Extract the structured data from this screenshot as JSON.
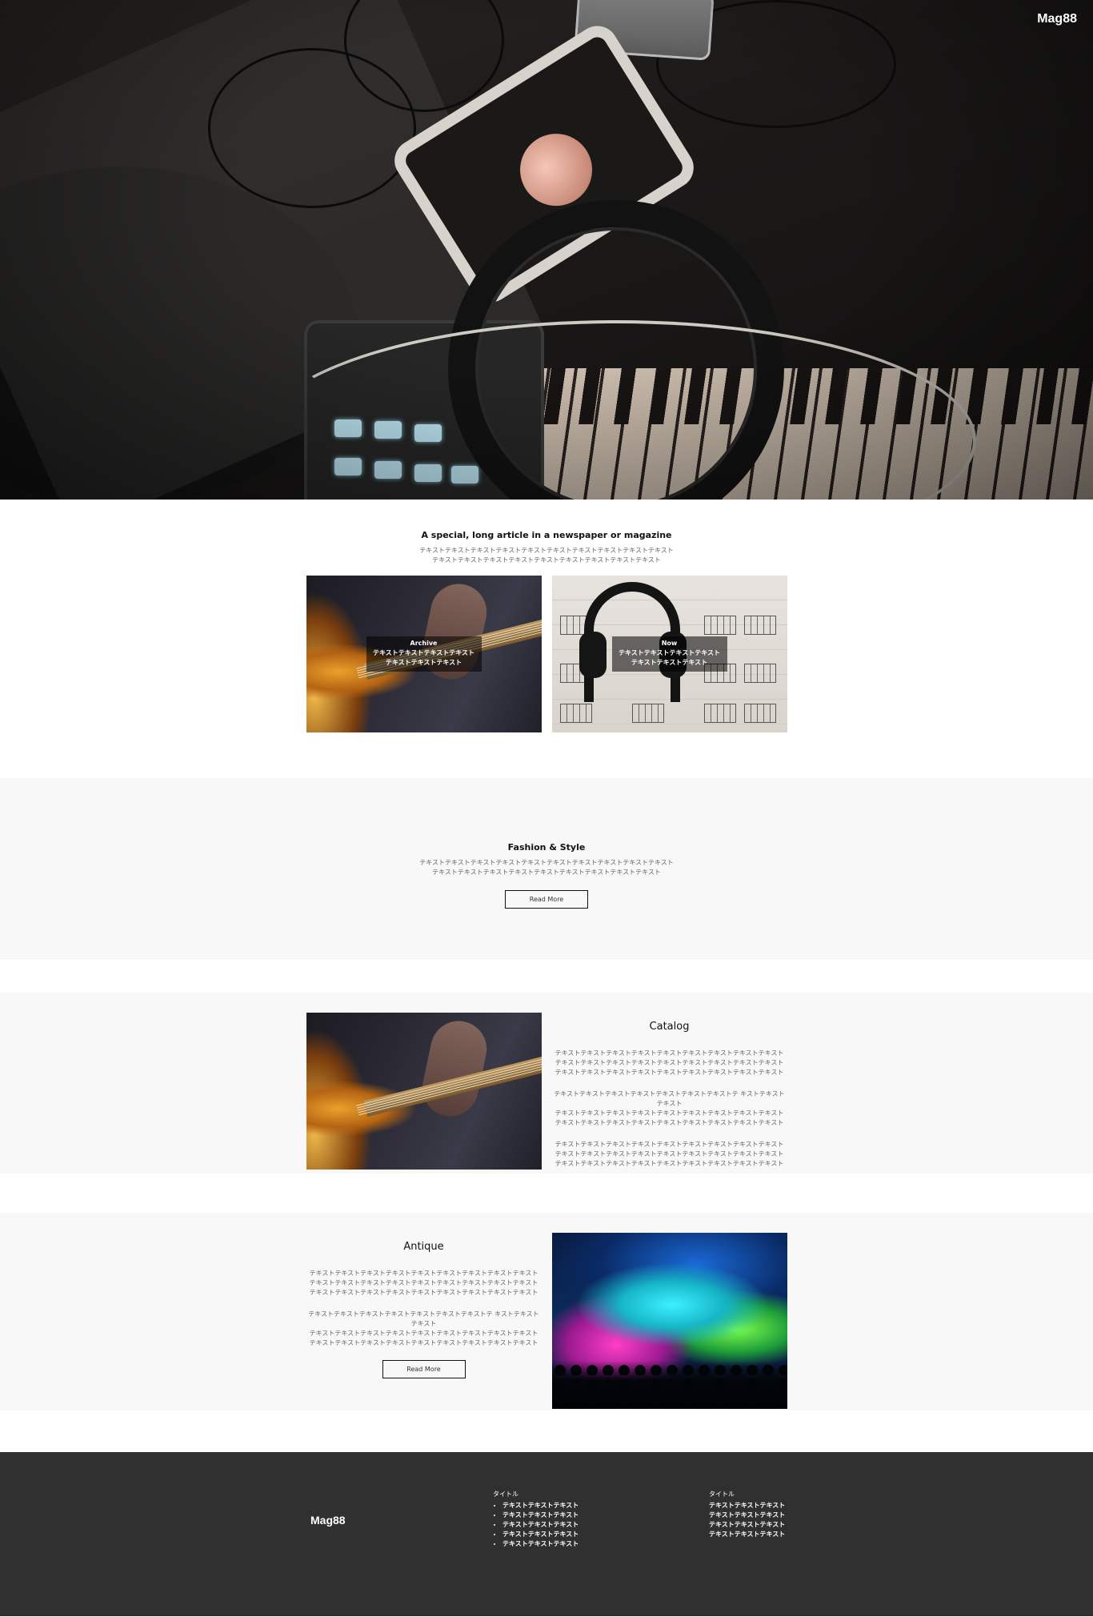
{
  "header": {
    "logo": "Mag88"
  },
  "special": {
    "title": "A special, long article in a newspaper or magazine",
    "text_lines": [
      "テキストテキストテキストテキストテキストテキストテキストテキストテキストテキスト",
      "テキストテキストテキストテキストテキストテキストテキストテキストテキスト"
    ],
    "cards": [
      {
        "title": "Archive",
        "line1": "テキストテキストテキストテキスト",
        "line2": "テキストテキストテキスト"
      },
      {
        "title": "Now",
        "line1": "テキストテキストテキストテキスト",
        "line2": "テキストテキストテキスト"
      }
    ]
  },
  "fashion": {
    "title": "Fashion & Style",
    "text_lines": [
      "テキストテキストテキストテキストテキストテキストテキストテキストテキストテキスト",
      "テキストテキストテキストテキストテキストテキストテキストテキストテキスト"
    ],
    "button": "Read More"
  },
  "catalog": {
    "title": "Catalog",
    "paragraphs": [
      [
        "テキストテキストテキストテキストテキストテキストテキストテキストテキスト",
        "テキストテキストテキストテキストテキストテキストテキストテキストテキスト",
        "テキストテキストテキストテキストテキストテキストテキストテキストテキスト"
      ],
      [
        "テキストテキストテキストテキストテキストテキストテキストテ キストテキストテキスト",
        "テキストテキストテキストテキストテキストテキストテキストテキストテキスト",
        "テキストテキストテキストテキストテキストテキストテキストテキストテキスト"
      ],
      [
        "テキストテキストテキストテキストテキストテキストテキストテキストテキスト",
        "テキストテキストテキストテキストテキストテキストテキストテキストテキスト",
        "テキストテキストテキストテキストテキストテキストテキストテキストテキスト"
      ]
    ]
  },
  "antique": {
    "title": "Antique",
    "paragraphs": [
      [
        "テキストテキストテキストテキストテキストテキストテキストテキストテキスト",
        "テキストテキストテキストテキストテキストテキストテキストテキストテキスト",
        "テキストテキストテキストテキストテキストテキストテキストテキストテキスト"
      ],
      [
        "テキストテキストテキストテキストテキストテキストテキストテ キストテキストテキスト",
        "テキストテキストテキストテキストテキストテキストテキストテキストテキスト",
        "テキストテキストテキストテキストテキストテキストテキストテキストテキスト"
      ]
    ],
    "button": "Read More"
  },
  "footer": {
    "logo": "Mag88",
    "col1": {
      "title": "タイトル",
      "items": [
        "テキストテキストテキスト",
        "テキストテキストテキスト",
        "テキストテキストテキスト",
        "テキストテキストテキスト",
        "テキストテキストテキスト"
      ]
    },
    "col2": {
      "title": "タイトル",
      "items": [
        "テキストテキストテキスト",
        "テキストテキストテキスト",
        "テキストテキストテキスト",
        "テキストテキストテキスト"
      ]
    }
  },
  "colors": {
    "footer_bg": "#303030",
    "section_bg": "#f8f8f8",
    "text": "#666666"
  }
}
